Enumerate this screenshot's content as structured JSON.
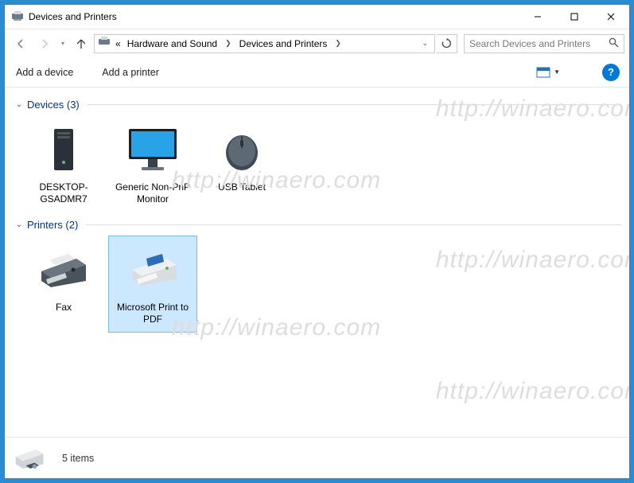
{
  "title": "Devices and Printers",
  "breadcrumb": {
    "prefix": "«",
    "seg1": "Hardware and Sound",
    "seg2": "Devices and Printers"
  },
  "search": {
    "placeholder": "Search Devices and Printers"
  },
  "toolbar": {
    "add_device": "Add a device",
    "add_printer": "Add a printer"
  },
  "groups": [
    {
      "name": "Devices",
      "count": "(3)",
      "items": [
        {
          "label": "DESKTOP-GSADMR7",
          "icon": "pc-tower"
        },
        {
          "label": "Generic Non-PnP Monitor",
          "icon": "monitor"
        },
        {
          "label": "USB Tablet",
          "icon": "mouse"
        }
      ]
    },
    {
      "name": "Printers",
      "count": "(2)",
      "items": [
        {
          "label": "Fax",
          "icon": "fax"
        },
        {
          "label": "Microsoft Print to PDF",
          "icon": "printer",
          "selected": true
        }
      ]
    }
  ],
  "status": {
    "text": "5 items"
  },
  "help_glyph": "?",
  "watermark": "http://winaero.com"
}
